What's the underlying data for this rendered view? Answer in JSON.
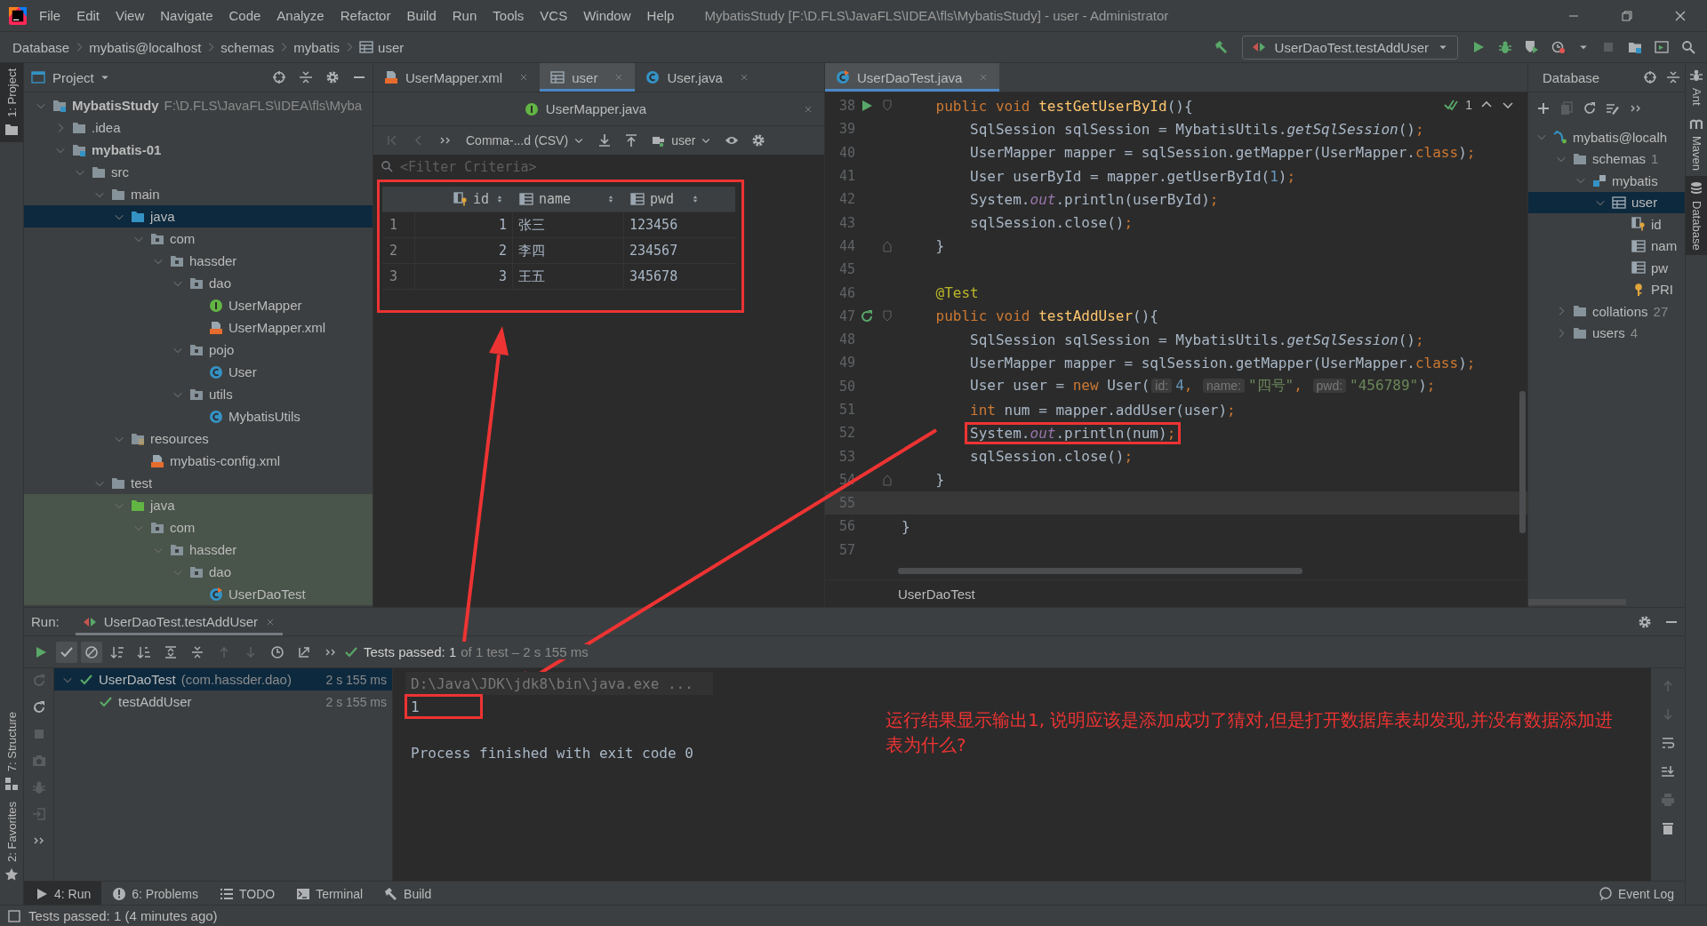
{
  "window": {
    "title": "MybatisStudy [F:\\D.FLS\\JavaFLS\\IDEA\\fls\\MybatisStudy] - user - Administrator"
  },
  "menu": [
    "File",
    "Edit",
    "View",
    "Navigate",
    "Code",
    "Analyze",
    "Refactor",
    "Build",
    "Run",
    "Tools",
    "VCS",
    "Window",
    "Help"
  ],
  "breadcrumb": [
    {
      "label": "Database",
      "kind": "text"
    },
    {
      "label": "mybatis@localhost",
      "kind": "text"
    },
    {
      "label": "schemas",
      "kind": "text"
    },
    {
      "label": "mybatis",
      "kind": "text"
    },
    {
      "label": "user",
      "kind": "table"
    }
  ],
  "run_config": "UserDaoTest.testAddUser",
  "left_strip": [
    {
      "label": "1: Project",
      "kind": "project",
      "selected": true
    },
    {
      "label": "7: Structure",
      "kind": "structure",
      "selected": false
    },
    {
      "label": "2: Favorites",
      "kind": "favorites",
      "selected": false
    }
  ],
  "right_strip": [
    {
      "label": "Ant",
      "kind": "ant",
      "selected": false
    },
    {
      "label": "Maven",
      "kind": "maven",
      "selected": false
    },
    {
      "label": "Database",
      "kind": "database",
      "selected": true
    }
  ],
  "project_panel": {
    "title": "Project",
    "tree": [
      {
        "label": "MybatisStudy",
        "path": "F:\\D.FLS\\JavaFLS\\IDEA\\fls\\Myba",
        "kind": "module",
        "bold": true,
        "expanded": true,
        "selected": false,
        "children": [
          {
            "label": ".idea",
            "kind": "folder",
            "bold": false,
            "expanded": false,
            "selected": false
          },
          {
            "label": "mybatis-01",
            "kind": "module",
            "bold": true,
            "expanded": true,
            "selected": false,
            "children": [
              {
                "label": "src",
                "kind": "folder",
                "bold": false,
                "expanded": true,
                "selected": false,
                "children": [
                  {
                    "label": "main",
                    "kind": "folder",
                    "bold": false,
                    "expanded": true,
                    "selected": false,
                    "children": [
                      {
                        "label": "java",
                        "kind": "source_root",
                        "bold": false,
                        "expanded": true,
                        "selected": true,
                        "children": [
                          {
                            "label": "com",
                            "kind": "package",
                            "bold": false,
                            "expanded": true,
                            "selected": false,
                            "children": [
                              {
                                "label": "hassder",
                                "kind": "package",
                                "bold": false,
                                "expanded": true,
                                "selected": false,
                                "children": [
                                  {
                                    "label": "dao",
                                    "kind": "package",
                                    "bold": false,
                                    "expanded": true,
                                    "selected": false,
                                    "children": [
                                      {
                                        "label": "UserMapper",
                                        "kind": "interface",
                                        "bold": false,
                                        "selected": false
                                      },
                                      {
                                        "label": "UserMapper.xml",
                                        "kind": "xml",
                                        "bold": false,
                                        "selected": false
                                      }
                                    ]
                                  },
                                  {
                                    "label": "pojo",
                                    "kind": "package",
                                    "bold": false,
                                    "expanded": true,
                                    "selected": false,
                                    "children": [
                                      {
                                        "label": "User",
                                        "kind": "class",
                                        "bold": false,
                                        "selected": false
                                      }
                                    ]
                                  },
                                  {
                                    "label": "utils",
                                    "kind": "package",
                                    "bold": false,
                                    "expanded": true,
                                    "selected": false,
                                    "children": [
                                      {
                                        "label": "MybatisUtils",
                                        "kind": "class",
                                        "bold": false,
                                        "selected": false
                                      }
                                    ]
                                  }
                                ]
                              }
                            ]
                          }
                        ]
                      },
                      {
                        "label": "resources",
                        "kind": "resources_root",
                        "bold": false,
                        "expanded": true,
                        "selected": false,
                        "children": [
                          {
                            "label": "mybatis-config.xml",
                            "kind": "xml",
                            "bold": false,
                            "selected": false
                          }
                        ]
                      }
                    ]
                  },
                  {
                    "label": "test",
                    "kind": "folder",
                    "bold": false,
                    "expanded": true,
                    "selected": false,
                    "children": [
                      {
                        "label": "java",
                        "kind": "test_root",
                        "bold": false,
                        "expanded": true,
                        "selected": false,
                        "children": [
                          {
                            "label": "com",
                            "kind": "package",
                            "bold": false,
                            "expanded": true,
                            "selected": false,
                            "children": [
                              {
                                "label": "hassder",
                                "kind": "package",
                                "bold": false,
                                "expanded": true,
                                "selected": false,
                                "children": [
                                  {
                                    "label": "dao",
                                    "kind": "package",
                                    "bold": false,
                                    "expanded": true,
                                    "selected": false,
                                    "children": [
                                      {
                                        "label": "UserDaoTest",
                                        "kind": "test_class",
                                        "bold": false,
                                        "selected": false
                                      }
                                    ]
                                  }
                                ]
                              }
                            ]
                          }
                        ]
                      }
                    ]
                  }
                ]
              }
            ]
          }
        ]
      }
    ]
  },
  "table_editor": {
    "tabs": [
      {
        "label": "UserMapper.xml",
        "kind": "xml",
        "selected": false
      },
      {
        "label": "user",
        "kind": "table",
        "selected": true
      },
      {
        "label": "User.java",
        "kind": "class",
        "selected": false
      }
    ],
    "second_row_tabs": [
      {
        "label": "UserMapper.java",
        "kind": "interface",
        "selected": false
      }
    ],
    "export_format": "Comma-...d (CSV)",
    "session": "user",
    "filter_placeholder": "<Filter Criteria>",
    "columns": [
      {
        "label": "id",
        "kind": "key_column"
      },
      {
        "label": "name",
        "kind": "column"
      },
      {
        "label": "pwd",
        "kind": "column"
      }
    ],
    "rows": [
      {
        "num": "1",
        "cells": [
          "1",
          "张三",
          "123456"
        ]
      },
      {
        "num": "2",
        "cells": [
          "2",
          "李四",
          "234567"
        ]
      },
      {
        "num": "3",
        "cells": [
          "3",
          "王五",
          "345678"
        ]
      }
    ]
  },
  "code_editor": {
    "tabs": [
      {
        "label": "UserDaoTest.java",
        "kind": "test_class",
        "selected": true
      }
    ],
    "inspection_count": "1",
    "breadcrumb": "UserDaoTest",
    "lines": [
      {
        "num": "38",
        "kind": "member",
        "markers": [
          {
            "kind": "run"
          },
          {
            "kind": "fold_start"
          }
        ],
        "current": false,
        "boxed": false,
        "tokens": [
          {
            "text": "public void ",
            "kind": "kw"
          },
          {
            "text": "testGetUserById",
            "kind": "decl"
          },
          {
            "text": "(){",
            "kind": "plain"
          }
        ]
      },
      {
        "num": "39",
        "kind": "body",
        "current": false,
        "boxed": false,
        "tokens": [
          {
            "text": "SqlSession sqlSession = MybatisUtils.",
            "kind": "plain"
          },
          {
            "text": "getSqlSession",
            "kind": "static"
          },
          {
            "text": "()",
            "kind": "plain"
          },
          {
            "text": ";",
            "kind": "kw"
          }
        ]
      },
      {
        "num": "40",
        "kind": "body",
        "current": false,
        "boxed": false,
        "tokens": [
          {
            "text": "UserMapper mapper = sqlSession.getMapper(UserMapper.",
            "kind": "plain"
          },
          {
            "text": "class",
            "kind": "kw"
          },
          {
            "text": ")",
            "kind": "plain"
          },
          {
            "text": ";",
            "kind": "kw"
          }
        ]
      },
      {
        "num": "41",
        "kind": "body",
        "current": false,
        "boxed": false,
        "tokens": [
          {
            "text": "User userById = mapper.getUserById(",
            "kind": "plain"
          },
          {
            "text": "1",
            "kind": "num"
          },
          {
            "text": ")",
            "kind": "plain"
          },
          {
            "text": ";",
            "kind": "kw"
          }
        ]
      },
      {
        "num": "42",
        "kind": "body",
        "current": false,
        "boxed": false,
        "tokens": [
          {
            "text": "System.",
            "kind": "plain"
          },
          {
            "text": "out",
            "kind": "field"
          },
          {
            "text": ".println(userById)",
            "kind": "plain"
          },
          {
            "text": ";",
            "kind": "kw"
          }
        ]
      },
      {
        "num": "43",
        "kind": "body",
        "current": false,
        "boxed": false,
        "tokens": [
          {
            "text": "sqlSession.close()",
            "kind": "plain"
          },
          {
            "text": ";",
            "kind": "kw"
          }
        ]
      },
      {
        "num": "44",
        "kind": "member",
        "markers": [
          {
            "kind": "fold_end"
          }
        ],
        "current": false,
        "boxed": false,
        "tokens": [
          {
            "text": "}",
            "kind": "plain"
          }
        ]
      },
      {
        "num": "45",
        "kind": "blank",
        "current": false,
        "boxed": false
      },
      {
        "num": "46",
        "kind": "member",
        "current": false,
        "boxed": false,
        "tokens": [
          {
            "text": "@Test",
            "kind": "ann"
          }
        ]
      },
      {
        "num": "47",
        "kind": "member",
        "markers": [
          {
            "kind": "rerun"
          },
          {
            "kind": "fold_start"
          }
        ],
        "current": false,
        "boxed": false,
        "tokens": [
          {
            "text": "public void ",
            "kind": "kw"
          },
          {
            "text": "testAddUser",
            "kind": "decl"
          },
          {
            "text": "(){",
            "kind": "plain"
          }
        ]
      },
      {
        "num": "48",
        "kind": "body",
        "current": false,
        "boxed": false,
        "tokens": [
          {
            "text": "SqlSession sqlSession = MybatisUtils.",
            "kind": "plain"
          },
          {
            "text": "getSqlSession",
            "kind": "static"
          },
          {
            "text": "()",
            "kind": "plain"
          },
          {
            "text": ";",
            "kind": "kw"
          }
        ]
      },
      {
        "num": "49",
        "kind": "body",
        "current": false,
        "boxed": false,
        "tokens": [
          {
            "text": "UserMapper mapper = sqlSession.getMapper(UserMapper.",
            "kind": "plain"
          },
          {
            "text": "class",
            "kind": "kw"
          },
          {
            "text": ")",
            "kind": "plain"
          },
          {
            "text": ";",
            "kind": "kw"
          }
        ]
      },
      {
        "num": "50",
        "kind": "body",
        "current": false,
        "boxed": false,
        "tokens": [
          {
            "text": "User user = ",
            "kind": "plain"
          },
          {
            "text": "new ",
            "kind": "kw"
          },
          {
            "text": "User(",
            "kind": "plain"
          },
          {
            "text": "id:",
            "kind": "hint"
          },
          {
            "text": "4",
            "kind": "num"
          },
          {
            "text": ", ",
            "kind": "kw"
          },
          {
            "text": "name:",
            "kind": "hint"
          },
          {
            "text": "\"四号\"",
            "kind": "str"
          },
          {
            "text": ", ",
            "kind": "kw"
          },
          {
            "text": "pwd:",
            "kind": "hint"
          },
          {
            "text": "\"456789\"",
            "kind": "str"
          },
          {
            "text": ")",
            "kind": "plain"
          },
          {
            "text": ";",
            "kind": "kw"
          }
        ]
      },
      {
        "num": "51",
        "kind": "body",
        "current": false,
        "boxed": false,
        "tokens": [
          {
            "text": "int ",
            "kind": "kw"
          },
          {
            "text": "num = mapper.addUser(user)",
            "kind": "plain"
          },
          {
            "text": ";",
            "kind": "kw"
          }
        ]
      },
      {
        "num": "52",
        "kind": "body",
        "current": false,
        "boxed": true,
        "tokens": [
          {
            "text": "System.",
            "kind": "plain"
          },
          {
            "text": "out",
            "kind": "field"
          },
          {
            "text": ".println(num)",
            "kind": "plain"
          },
          {
            "text": ";",
            "kind": "kw"
          }
        ]
      },
      {
        "num": "53",
        "kind": "body",
        "current": false,
        "boxed": false,
        "tokens": [
          {
            "text": "sqlSession.close()",
            "kind": "plain"
          },
          {
            "text": ";",
            "kind": "kw"
          }
        ]
      },
      {
        "num": "54",
        "kind": "member",
        "markers": [
          {
            "kind": "fold_end"
          }
        ],
        "current": false,
        "boxed": false,
        "tokens": [
          {
            "text": "}",
            "kind": "plain"
          }
        ]
      },
      {
        "num": "55",
        "kind": "blank",
        "current": true,
        "boxed": false
      },
      {
        "num": "56",
        "kind": "class",
        "current": false,
        "boxed": false,
        "tokens": [
          {
            "text": "}",
            "kind": "plain"
          }
        ]
      },
      {
        "num": "57",
        "kind": "blank",
        "current": false,
        "boxed": false
      }
    ]
  },
  "database_panel": {
    "title": "Database",
    "tree": [
      {
        "label": "mybatis@localh",
        "kind": "datasource",
        "expanded": true,
        "selected": false,
        "children": [
          {
            "label": "schemas",
            "count": "1",
            "kind": "folder",
            "expanded": true,
            "selected": false,
            "children": [
              {
                "label": "mybatis",
                "kind": "schema",
                "expanded": true,
                "selected": false,
                "children": [
                  {
                    "label": "user",
                    "kind": "table",
                    "expanded": true,
                    "selected": true,
                    "children": [
                      {
                        "label": "id",
                        "kind": "key_column",
                        "selected": false
                      },
                      {
                        "label": "nam",
                        "kind": "column",
                        "selected": false
                      },
                      {
                        "label": "pw",
                        "kind": "column",
                        "selected": false
                      },
                      {
                        "label": "PRI",
                        "kind": "key",
                        "selected": false
                      }
                    ]
                  }
                ]
              }
            ]
          },
          {
            "label": "collations",
            "count": "27",
            "kind": "folder",
            "expanded": false,
            "selected": false
          },
          {
            "label": "users",
            "count": "4",
            "kind": "folder",
            "expanded": false,
            "selected": false
          }
        ]
      }
    ]
  },
  "run_panel": {
    "label": "Run:",
    "tab": "UserDaoTest.testAddUser",
    "summary": "Tests passed: 1",
    "summary_detail": "of 1 test – 2 s 155 ms",
    "tests": [
      {
        "name": "UserDaoTest",
        "detail": "(com.hassder.dao)",
        "duration": "2 s 155 ms",
        "passed": true,
        "expanded": true,
        "selected": true,
        "children": [
          {
            "name": "testAddUser",
            "duration": "2 s 155 ms",
            "passed": true,
            "selected": false
          }
        ]
      }
    ],
    "console": [
      {
        "text": "D:\\Java\\JDK\\jdk8\\bin\\java.exe ...",
        "kind": "command",
        "boxed": false
      },
      {
        "text": "1",
        "kind": "output",
        "boxed": true
      },
      {
        "text": "Process finished with exit code 0",
        "kind": "exit",
        "boxed": false
      }
    ],
    "note": "运行结果显示输出1, 说明应该是添加成功了猜对,但是打开数据库表却发现,并没有数据添加进表为什么?"
  },
  "bottom_tabs": [
    {
      "label": "4: Run",
      "kind": "run",
      "selected": true
    },
    {
      "label": "6: Problems",
      "kind": "problems",
      "selected": false
    },
    {
      "label": "TODO",
      "kind": "todo",
      "selected": false
    },
    {
      "label": "Terminal",
      "kind": "terminal",
      "selected": false
    },
    {
      "label": "Build",
      "kind": "build",
      "selected": false
    }
  ],
  "event_log": "Event Log",
  "status": "Tests passed: 1 (4 minutes ago)"
}
